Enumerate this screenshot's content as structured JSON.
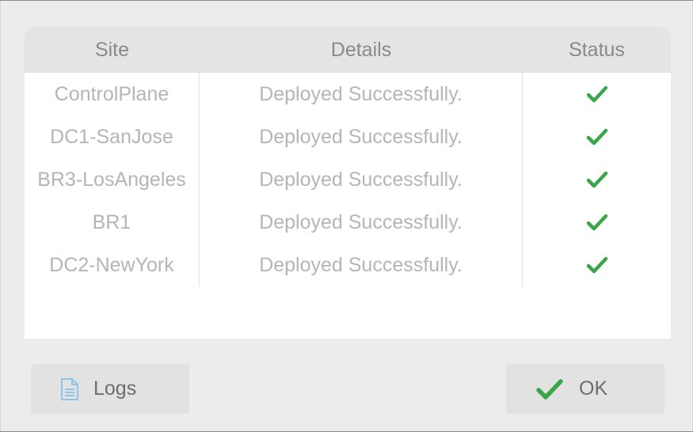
{
  "table": {
    "headers": {
      "site": "Site",
      "details": "Details",
      "status": "Status"
    },
    "rows": [
      {
        "site": "ControlPlane",
        "details": "Deployed Successfully.",
        "status_icon": "check-icon"
      },
      {
        "site": "DC1-SanJose",
        "details": "Deployed Successfully.",
        "status_icon": "check-icon"
      },
      {
        "site": "BR3-LosAngeles",
        "details": "Deployed Successfully.",
        "status_icon": "check-icon"
      },
      {
        "site": "BR1",
        "details": "Deployed Successfully.",
        "status_icon": "check-icon"
      },
      {
        "site": "DC2-NewYork",
        "details": "Deployed Successfully.",
        "status_icon": "check-icon"
      }
    ]
  },
  "buttons": {
    "logs": {
      "label": "Logs",
      "icon": "document-icon"
    },
    "ok": {
      "label": "OK",
      "icon": "check-icon"
    }
  },
  "colors": {
    "success": "#3aa64a",
    "doc_icon": "#8fc4ea",
    "header_bg": "#e4e4e4",
    "button_bg": "#e2e2e2"
  }
}
